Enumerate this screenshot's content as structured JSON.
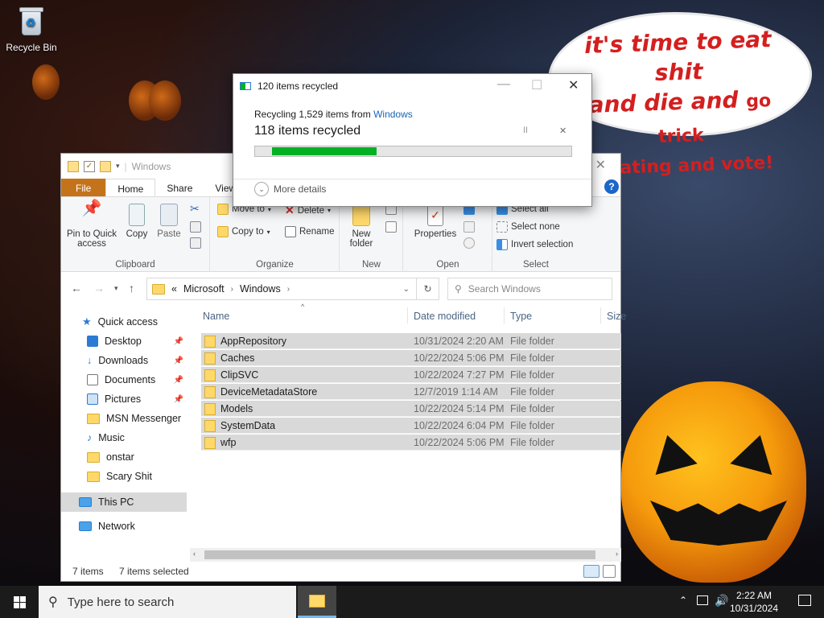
{
  "desktop": {
    "recycle_bin_label": "Recycle Bin",
    "speech_bubble": {
      "line1": "it's time to eat shit",
      "line2a": "and die and",
      "line2b": "go trick",
      "line3": "treating and vote!"
    }
  },
  "explorer": {
    "title": "Windows",
    "tabs": [
      "File",
      "Home",
      "Share",
      "View"
    ],
    "ribbon": {
      "clipboard": {
        "pin_label": "Pin to Quick access",
        "copy_label": "Copy",
        "paste_label": "Paste",
        "group_label": "Clipboard"
      },
      "organize": {
        "move_to": "Move to",
        "copy_to": "Copy to",
        "delete": "Delete",
        "rename": "Rename",
        "group_label": "Organize"
      },
      "new": {
        "new_folder": "New folder",
        "group_label": "New"
      },
      "open": {
        "properties": "Properties",
        "group_label": "Open"
      },
      "select": {
        "select_all": "Select all",
        "select_none": "Select none",
        "invert_selection": "Invert selection",
        "group_label": "Select"
      }
    },
    "address": {
      "overflow": "«",
      "crumbs": [
        "Microsoft",
        "Windows"
      ],
      "search_placeholder": "Search Windows"
    },
    "nav": {
      "quick_access": "Quick access",
      "items": [
        {
          "label": "Desktop",
          "pinned": true
        },
        {
          "label": "Downloads",
          "pinned": true
        },
        {
          "label": "Documents",
          "pinned": true
        },
        {
          "label": "Pictures",
          "pinned": true
        },
        {
          "label": "MSN Messenger",
          "pinned": false
        },
        {
          "label": "Music",
          "pinned": false
        },
        {
          "label": "onstar",
          "pinned": false
        },
        {
          "label": "Scary Shit",
          "pinned": false
        }
      ],
      "this_pc": "This PC",
      "network": "Network"
    },
    "columns": {
      "name": "Name",
      "date": "Date modified",
      "type": "Type",
      "size": "Size"
    },
    "files": [
      {
        "name": "AppRepository",
        "date": "10/31/2024 2:20 AM",
        "type": "File folder"
      },
      {
        "name": "Caches",
        "date": "10/22/2024 5:06 PM",
        "type": "File folder"
      },
      {
        "name": "ClipSVC",
        "date": "10/22/2024 7:27 PM",
        "type": "File folder"
      },
      {
        "name": "DeviceMetadataStore",
        "date": "12/7/2019 1:14 AM",
        "type": "File folder"
      },
      {
        "name": "Models",
        "date": "10/22/2024 5:14 PM",
        "type": "File folder"
      },
      {
        "name": "SystemData",
        "date": "10/22/2024 6:04 PM",
        "type": "File folder"
      },
      {
        "name": "wfp",
        "date": "10/22/2024 5:06 PM",
        "type": "File folder"
      }
    ],
    "status": {
      "count": "7 items",
      "selected": "7 items selected"
    }
  },
  "dialog": {
    "title": "120 items recycled",
    "line1_prefix": "Recycling 1,529 items from",
    "line1_link": "Windows",
    "line2": "118 items recycled",
    "progress_fraction": 0.33,
    "more_details": "More details",
    "pause_glyph": "II",
    "cancel_glyph": "✕"
  },
  "taskbar": {
    "search_placeholder": "Type here to search",
    "time": "2:22 AM",
    "date": "10/31/2024"
  }
}
